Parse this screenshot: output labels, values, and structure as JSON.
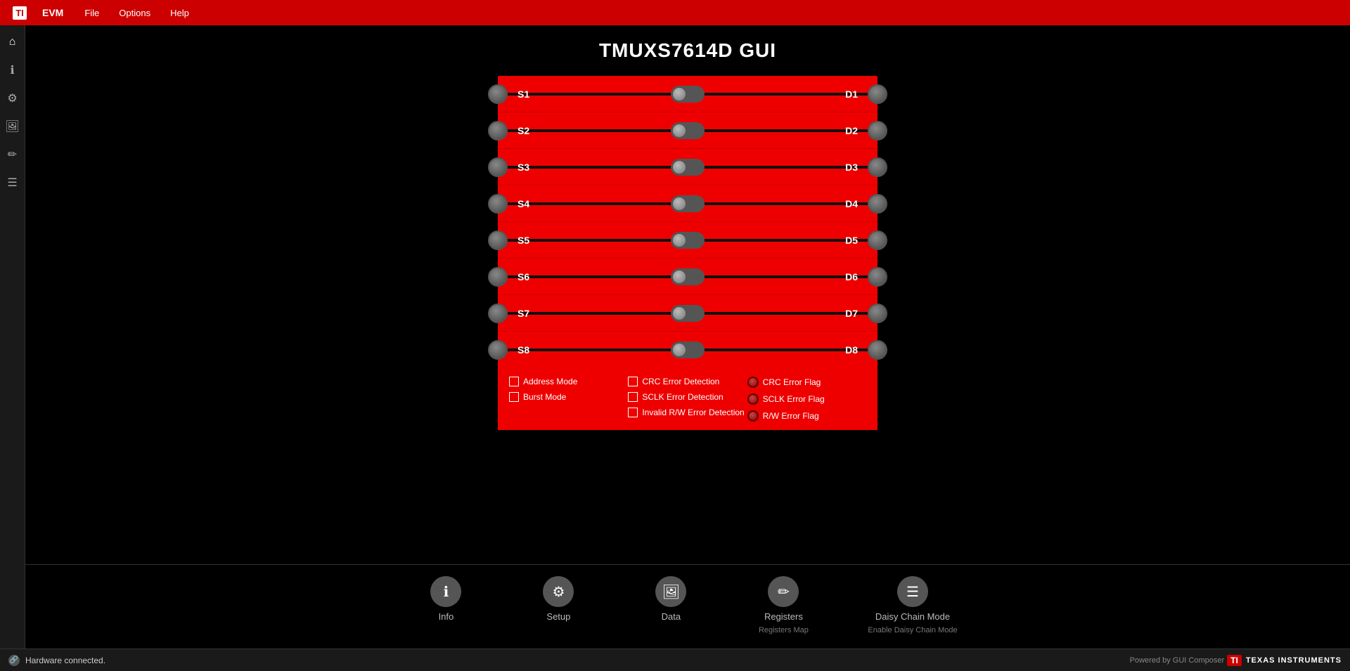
{
  "app": {
    "title": "EVM",
    "page_title": "TMUXS7614D GUI"
  },
  "menu": {
    "items": [
      "File",
      "Options",
      "Help"
    ]
  },
  "sidebar": {
    "icons": [
      {
        "name": "home-icon",
        "symbol": "⌂"
      },
      {
        "name": "info-icon",
        "symbol": "ℹ"
      },
      {
        "name": "gear-icon",
        "symbol": "⚙"
      },
      {
        "name": "image-icon",
        "symbol": "🖼"
      },
      {
        "name": "pencil-icon",
        "symbol": "✏"
      },
      {
        "name": "list-icon",
        "symbol": "☰"
      }
    ]
  },
  "switches": [
    {
      "left": "S1",
      "right": "D1"
    },
    {
      "left": "S2",
      "right": "D2"
    },
    {
      "left": "S3",
      "right": "D3"
    },
    {
      "left": "S4",
      "right": "D4"
    },
    {
      "left": "S5",
      "right": "D5"
    },
    {
      "left": "S6",
      "right": "D6"
    },
    {
      "left": "S7",
      "right": "D7"
    },
    {
      "left": "S8",
      "right": "D8"
    }
  ],
  "checkboxes": {
    "col1": [
      {
        "label": "Address Mode",
        "checked": false
      },
      {
        "label": "Burst Mode",
        "checked": false
      }
    ],
    "col2": [
      {
        "label": "CRC Error Detection",
        "checked": false
      },
      {
        "label": "SCLK Error Detection",
        "checked": false
      },
      {
        "label": "Invalid R/W Error Detection",
        "checked": false
      }
    ],
    "col3": [
      {
        "label": "CRC Error Flag"
      },
      {
        "label": "SCLK Error Flag"
      },
      {
        "label": "R/W Error Flag"
      }
    ]
  },
  "bottom_nav": [
    {
      "icon": "ℹ",
      "label": "Info",
      "sublabel": ""
    },
    {
      "icon": "⚙",
      "label": "Setup",
      "sublabel": ""
    },
    {
      "icon": "🖼",
      "label": "Data",
      "sublabel": ""
    },
    {
      "icon": "✏",
      "label": "Registers",
      "sublabel": "Registers Map"
    },
    {
      "icon": "☰",
      "label": "Daisy Chain Mode",
      "sublabel": "Enable Daisy Chain Mode"
    }
  ],
  "status": {
    "message": "Hardware connected.",
    "powered_by": "Powered by GUI Composer"
  }
}
